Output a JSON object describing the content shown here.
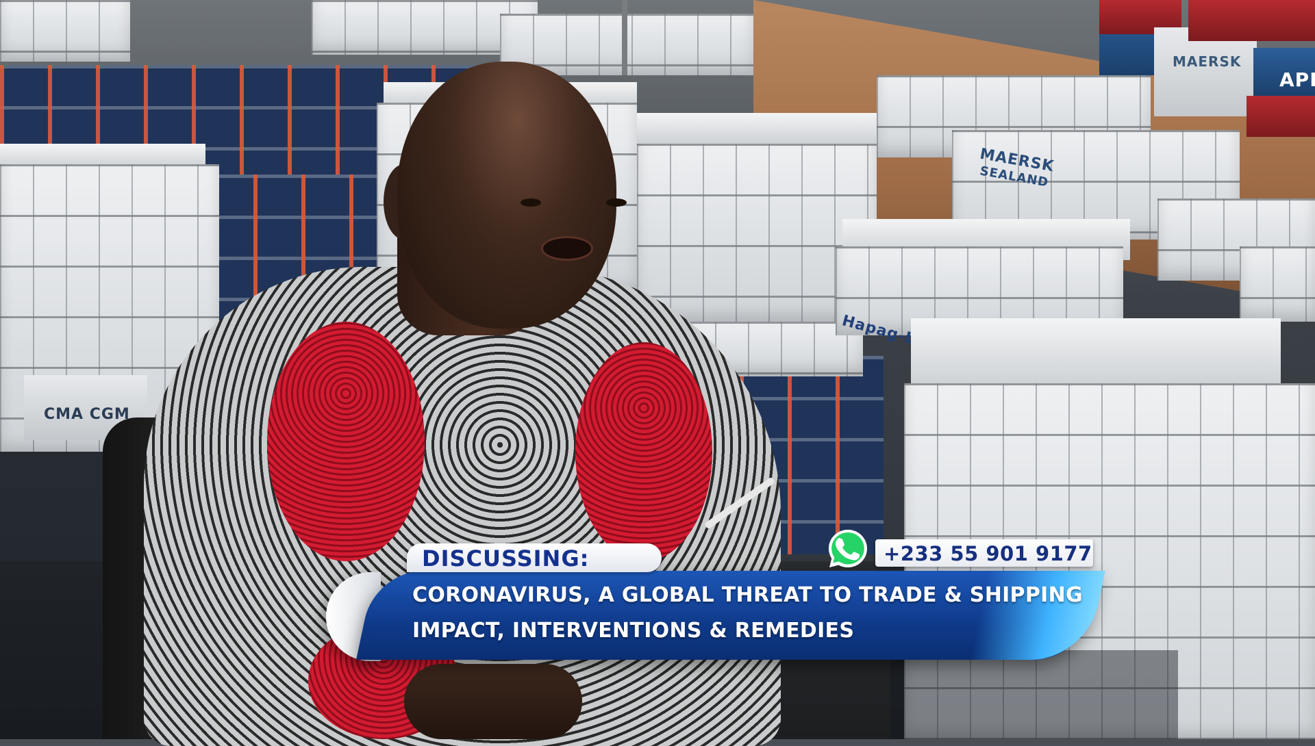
{
  "background": {
    "container_brand_1": "MAERSK",
    "container_brand_2": "SEALAND",
    "container_brand_3": "CMA CGM",
    "container_brand_4": "Hapag-L",
    "container_brand_5": "APL"
  },
  "lower_third": {
    "label": "DISCUSSING:",
    "headline_line1": "CORONAVIRUS, A GLOBAL THREAT TO TRADE & SHIPPING",
    "headline_line2": "IMPACT, INTERVENTIONS & REMEDIES",
    "phone": "+233 55 901 9177",
    "phone_icon": "whatsapp-icon"
  },
  "colors": {
    "banner_blue": "#0f3a8a",
    "label_text": "#15318e",
    "accent_cyan": "#3fb3ff",
    "whatsapp_green": "#25d366"
  }
}
